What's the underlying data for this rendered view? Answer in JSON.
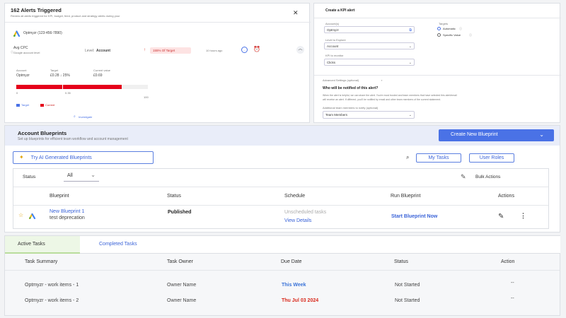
{
  "alerts_panel": {
    "title": "162 Alerts Triggered",
    "subtitle": "Review all alerts triggered for KPI, budget, feed, product and strategy alerts during your",
    "account_name": "Optmyzr (123-456-7890)",
    "metric_name": "Avg CPC",
    "metric_sub": "Google account level",
    "level_label": "Level:",
    "level_value": "Account",
    "badge_text": "155% Of Target",
    "time_ago": "10 hours ago",
    "account_label": "Account",
    "account_value": "Optmyzr",
    "target_label": "Target",
    "target_value": "£0.28 ↓ 25%",
    "current_label": "Current value",
    "current_value": "£0.69",
    "scale_start": "0",
    "scale_mid": "0.35",
    "scale_end": "100",
    "current_fraction": 0.8,
    "target_fraction": 0.35,
    "legend_target": "Target",
    "legend_current": "Current",
    "investigate_label": "Investigate",
    "close_icon": "close-icon"
  },
  "kpi_panel": {
    "title": "Create a KPI alert",
    "account_label": "Account(s)",
    "account_value": "Optmyzr",
    "level_label": "Level to Explore",
    "level_value": "Account",
    "kpi_label": "KPI to monitor",
    "kpi_value": "Clicks",
    "targets_label": "Targets",
    "target_option_1": "Automatic",
    "target_option_2": "Specific Value",
    "advanced_label": "Advanced Settings (optional)",
    "notify_title": "Who will be notified of this alert?",
    "notify_text_1": "When the alert is helpful, we can share the alert. You're most trusted and team members that have selected this alert/email",
    "notify_text_2": "will receive an alert. If different, you'll be notified by email and other team members of the current statement.",
    "additional_label": "Additional team members to notify (optional)",
    "team_value": "Team Members"
  },
  "blueprints": {
    "title": "Account Blueprints",
    "subtitle": "Set up blueprints for efficient team workflow and account management",
    "create_button": "Create New Blueprint",
    "ai_button": "Try AI Generated Blueprints",
    "my_tasks": "My Tasks",
    "user_roles": "User Roles",
    "status_label": "Status",
    "status_value": "All",
    "bulk_actions": "Bulk Actions",
    "columns": [
      "Blueprint",
      "Status",
      "Schedule",
      "Run Blueprint",
      "Actions"
    ],
    "row": {
      "name": "New Blueprint 1",
      "desc": "test deprecation",
      "status": "Published",
      "schedule": "Unscheduled tasks",
      "view_details": "View Details",
      "run": "Start Blueprint Now"
    }
  },
  "tasks": {
    "tab_active": "Active Tasks",
    "tab_completed": "Completed Tasks",
    "columns": [
      "Task Summary",
      "Task Owner",
      "Due Date",
      "Status",
      "Action"
    ],
    "rows": [
      {
        "summary": "Optmyzr - work items - 1",
        "owner": "Owner Name",
        "due": "This Week",
        "status": "Not Started",
        "action": "--"
      },
      {
        "summary": "Optmyzr - work items - 2",
        "owner": "Owner Name",
        "due": "Thu Jul 03 2024",
        "status": "Not Started",
        "action": "--"
      }
    ]
  },
  "colors": {
    "primary": "#4a72e6",
    "red_bar": "#e5001a",
    "due_blue": "#3a73d8",
    "due_red": "#d9291c"
  }
}
